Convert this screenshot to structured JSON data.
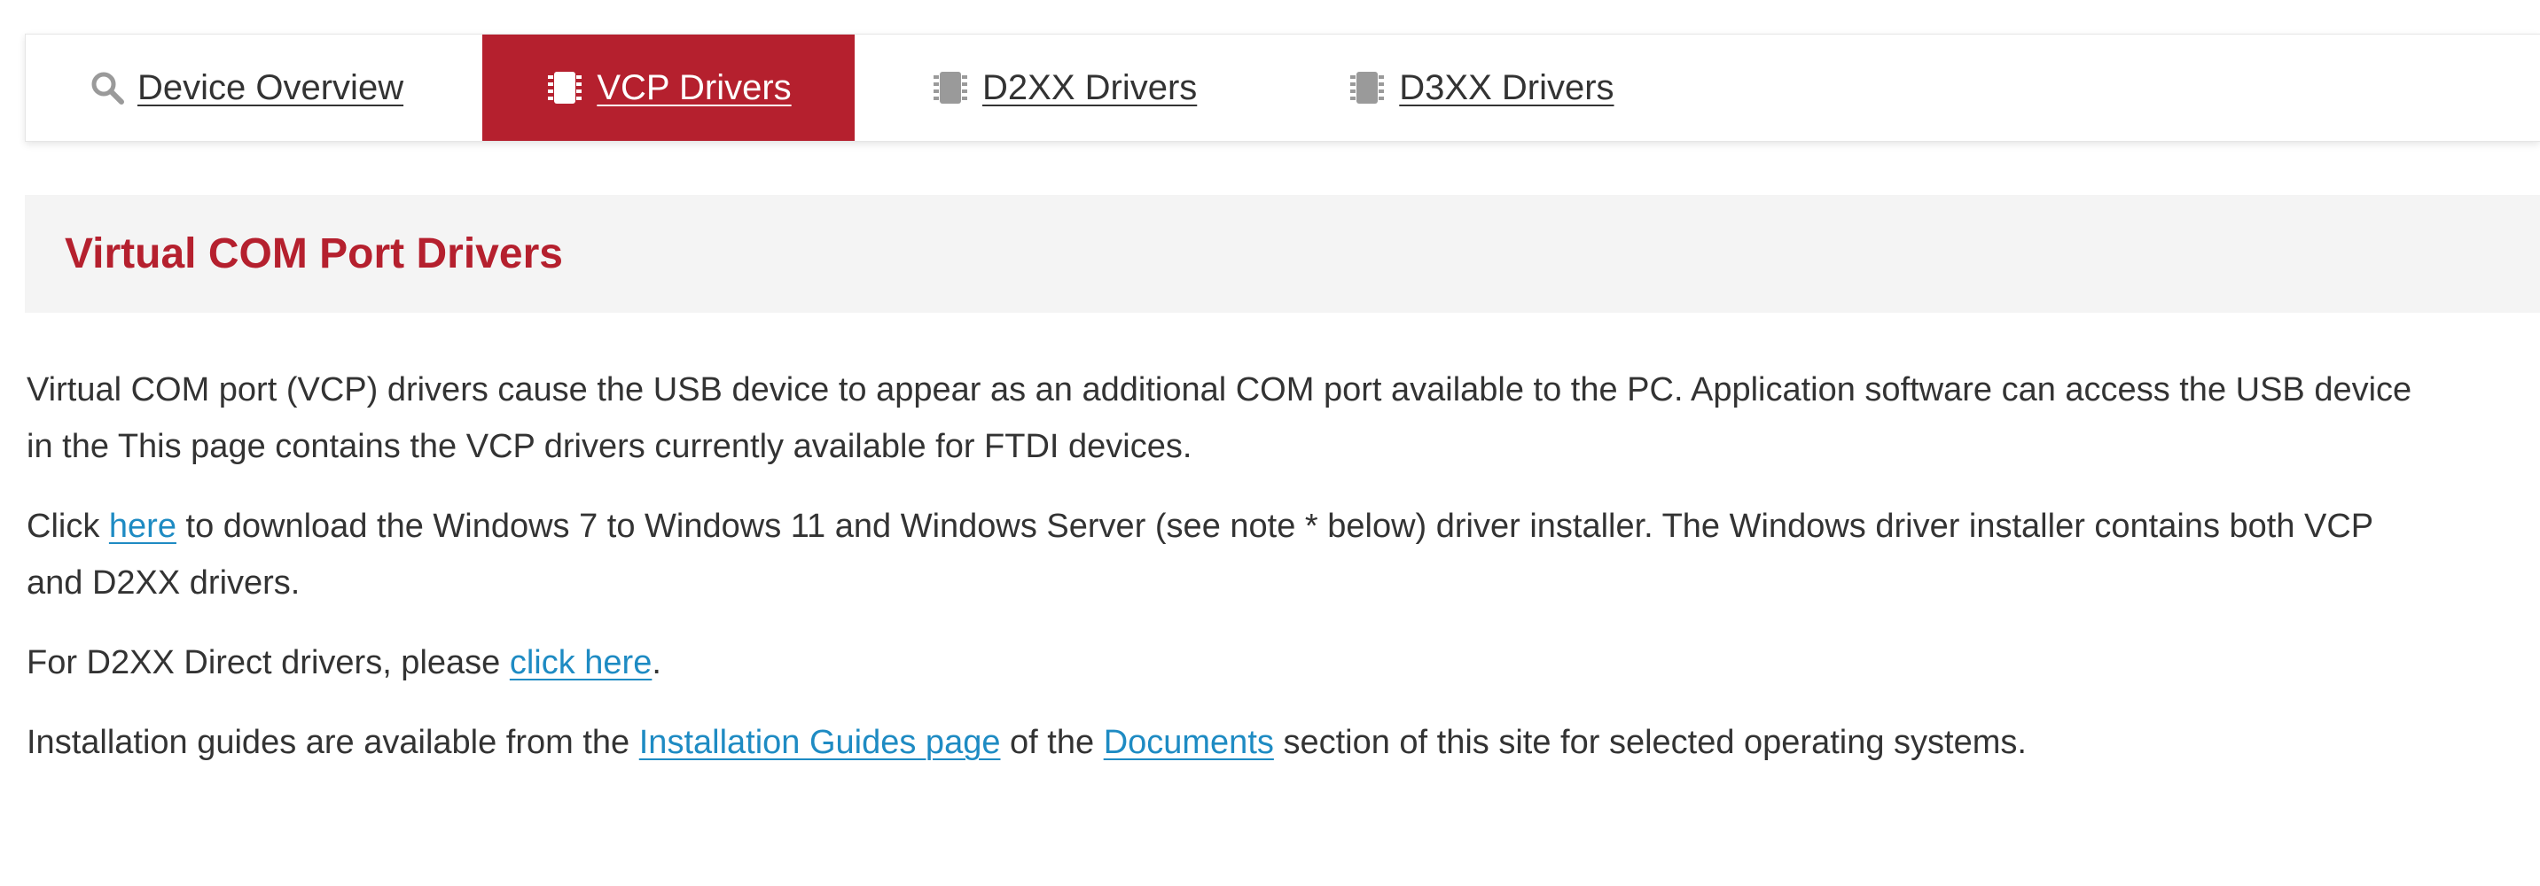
{
  "tabs": [
    {
      "label": "Device Overview",
      "icon": "search-icon",
      "active": false
    },
    {
      "label": "VCP Drivers",
      "icon": "chip-icon",
      "active": true
    },
    {
      "label": "D2XX Drivers",
      "icon": "chip-icon",
      "active": false
    },
    {
      "label": "D3XX Drivers",
      "icon": "chip-icon",
      "active": false
    }
  ],
  "section": {
    "title": "Virtual COM Port Drivers"
  },
  "content": {
    "p1": "Virtual COM port (VCP) drivers cause the USB device to appear as an additional COM port available to the PC. Application software can access the USB device in the This page contains the VCP drivers currently available for FTDI devices.",
    "p2_prefix": "Click ",
    "p2_link": "here",
    "p2_suffix": " to download the Windows 7 to Windows 11 and Windows Server (see note * below) driver installer. The Windows driver installer contains both VCP and D2XX drivers.",
    "p3_prefix": "For D2XX Direct drivers, please ",
    "p3_link": "click here",
    "p3_suffix": ".",
    "p4_prefix": "Installation guides are available from the ",
    "p4_link1": "Installation Guides page",
    "p4_middle": " of the ",
    "p4_link2": "Documents",
    "p4_suffix": " section of this site for selected operating systems."
  },
  "colors": {
    "accent": "#b5202e",
    "link": "#1e8bc3",
    "text": "#333333",
    "header_bg": "#f4f4f4",
    "icon_gray": "#9a9a9a"
  }
}
